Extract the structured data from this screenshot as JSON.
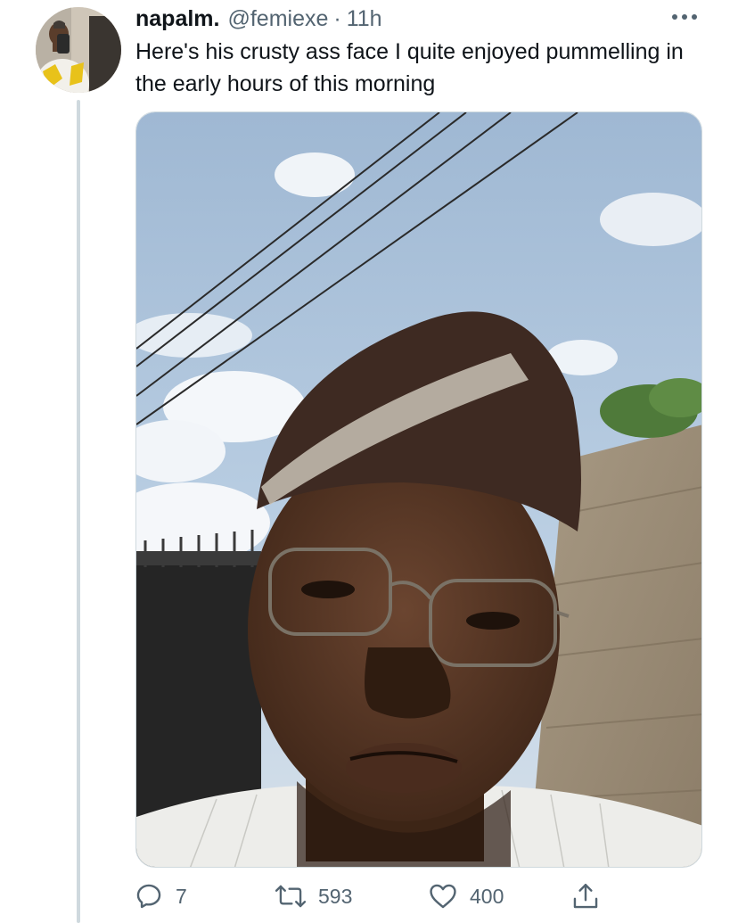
{
  "tweet": {
    "display_name": "napalm.",
    "handle": "@femiexe",
    "separator": "·",
    "time": "11h",
    "text": "Here's his crusty ass face I quite enjoyed pummelling in the early hours of this morning"
  },
  "actions": {
    "reply_count": "7",
    "retweet_count": "593",
    "like_count": "400"
  },
  "icons": {
    "more": "more-horizontal-icon",
    "reply": "reply-icon",
    "retweet": "retweet-icon",
    "like": "heart-icon",
    "share": "share-icon"
  },
  "colors": {
    "text_primary": "#0f1419",
    "text_secondary": "#536471",
    "thread_line": "#cfd9de"
  }
}
